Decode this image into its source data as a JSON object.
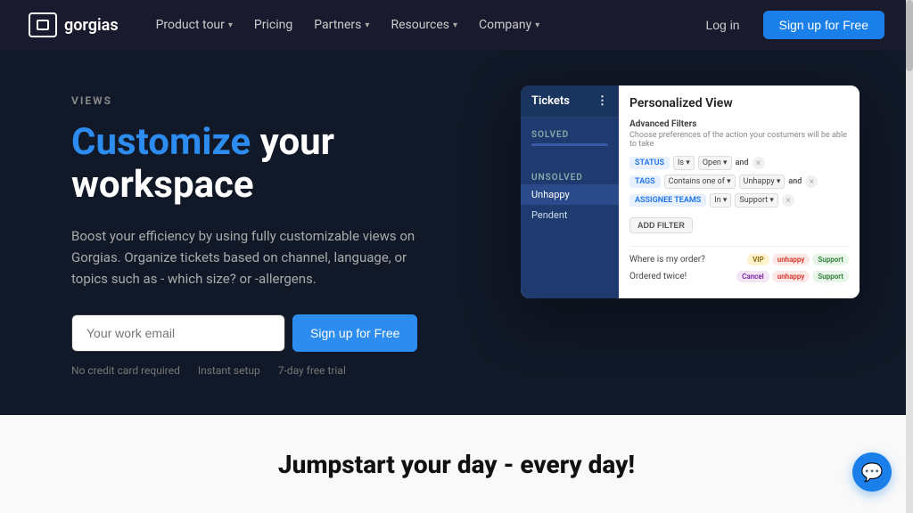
{
  "brand": {
    "name": "gorgias"
  },
  "navbar": {
    "logo_text": "gorgias",
    "login_label": "Log in",
    "signup_label": "Sign up for Free",
    "nav_items": [
      {
        "label": "Product tour",
        "has_dropdown": true
      },
      {
        "label": "Pricing",
        "has_dropdown": false
      },
      {
        "label": "Partners",
        "has_dropdown": true
      },
      {
        "label": "Resources",
        "has_dropdown": true
      },
      {
        "label": "Company",
        "has_dropdown": true
      }
    ]
  },
  "hero": {
    "views_label": "VIEWS",
    "title_highlight": "Customize",
    "title_rest": " your workspace",
    "description": "Boost your efficiency by using fully customizable views on Gorgias. Organize tickets based on channel, language, or topics such as - which size? or -allergens.",
    "email_placeholder": "Your work email",
    "cta_label": "Sign up for Free",
    "notes": [
      "No credit card required",
      "Instant setup",
      "7-day free trial"
    ]
  },
  "mockup": {
    "sidebar_header": "Tickets",
    "dots": "⋮",
    "solved_label": "Solved",
    "unsolved_label": "Unsolved",
    "unhappy_label": "Unhappy",
    "pendent_label": "Pendent",
    "main_title": "Personalized View",
    "advanced_filters_label": "Advanced Filters",
    "filters_subtitle": "Choose preferences of the action your costumers will be able to take",
    "status_tag": "STATUS",
    "tags_tag": "TAGS",
    "assignee_tag": "ASSIGNEE TEAMS",
    "add_filter": "ADD FILTER",
    "filter_rows": [
      {
        "tag": "STATUS",
        "tag_type": "blue",
        "operator": "Is",
        "value": "Open",
        "connector": "and"
      },
      {
        "tag": "TAGS",
        "tag_type": "blue",
        "operator": "Contains one of",
        "value": "Unhappy",
        "connector": "and"
      },
      {
        "tag": "ASSIGNEE TEAMS",
        "tag_type": "blue",
        "operator": "In",
        "value": "Support"
      }
    ],
    "result_rows": [
      {
        "label": "Where is my order?",
        "tags": [
          {
            "text": "VIP",
            "type": "vip"
          },
          {
            "text": "unhappy",
            "type": "unhappy"
          },
          {
            "text": "Support",
            "type": "support"
          }
        ]
      },
      {
        "label": "Ordered twice!",
        "tags": [
          {
            "text": "Cancel",
            "type": "cancel"
          },
          {
            "text": "unhappy",
            "type": "unhappy"
          },
          {
            "text": "Support",
            "type": "support"
          }
        ]
      }
    ]
  },
  "bottom": {
    "title": "Jumpstart your day - every day!"
  },
  "chat": {
    "icon": "💬"
  }
}
